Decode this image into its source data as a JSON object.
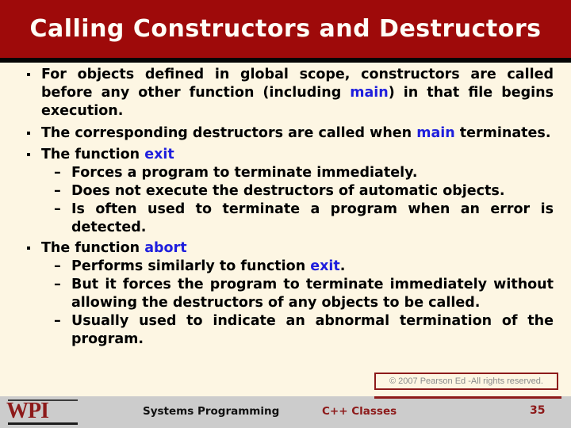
{
  "slide": {
    "title": "Calling Constructors and Destructors",
    "colors": {
      "title_band": "#9e0a0a",
      "background": "#fdf6e3",
      "body_text": "#000000",
      "code_accent": "#1f1fdd",
      "brand_red": "#8d1a1a",
      "footer_bar": "#cccccc"
    },
    "bullets": [
      {
        "marker": "square",
        "text_parts": [
          {
            "type": "text",
            "value": "For objects defined in global scope, constructors are called before any other function (including "
          },
          {
            "type": "code",
            "value": "main"
          },
          {
            "type": "text",
            "value": ") in that file begins execution."
          }
        ],
        "children": []
      },
      {
        "marker": "square",
        "text_parts": [
          {
            "type": "text",
            "value": "The corresponding destructors are called when "
          },
          {
            "type": "code",
            "value": "main"
          },
          {
            "type": "text",
            "value": " terminates."
          }
        ],
        "children": []
      },
      {
        "marker": "square",
        "text_parts": [
          {
            "type": "text",
            "value": "The function "
          },
          {
            "type": "code",
            "value": "exit"
          }
        ],
        "children": [
          {
            "marker": "dash",
            "dash": "–",
            "text_parts": [
              {
                "type": "text",
                "value": "Forces a program to terminate immediately."
              }
            ]
          },
          {
            "marker": "dash",
            "dash": "–",
            "text_parts": [
              {
                "type": "text",
                "value": "Does not execute the destructors of automatic objects."
              }
            ]
          },
          {
            "marker": "dash",
            "dash": "–",
            "text_parts": [
              {
                "type": "text",
                "value": "Is often used to terminate a program when an error is detected."
              }
            ]
          }
        ]
      },
      {
        "marker": "square",
        "text_parts": [
          {
            "type": "text",
            "value": "The function "
          },
          {
            "type": "code",
            "value": "abort"
          }
        ],
        "children": [
          {
            "marker": "dash",
            "dash": "–",
            "text_parts": [
              {
                "type": "text",
                "value": "Performs similarly to function "
              },
              {
                "type": "code",
                "value": "exit"
              },
              {
                "type": "text",
                "value": "."
              }
            ]
          },
          {
            "marker": "dash",
            "dash": "–",
            "text_parts": [
              {
                "type": "text",
                "value": "But it forces the program to terminate immediately without allowing the destructors of any objects to be called."
              }
            ]
          },
          {
            "marker": "dash",
            "dash": "–",
            "text_parts": [
              {
                "type": "text",
                "value": "Usually used to indicate an abnormal termination of the program."
              }
            ]
          }
        ]
      }
    ]
  },
  "copyright": {
    "text": "© 2007 Pearson Ed -All rights reserved."
  },
  "footer": {
    "logo_text": "WPI",
    "course": "Systems Programming",
    "topic": "C++ Classes",
    "page_number": "35"
  }
}
